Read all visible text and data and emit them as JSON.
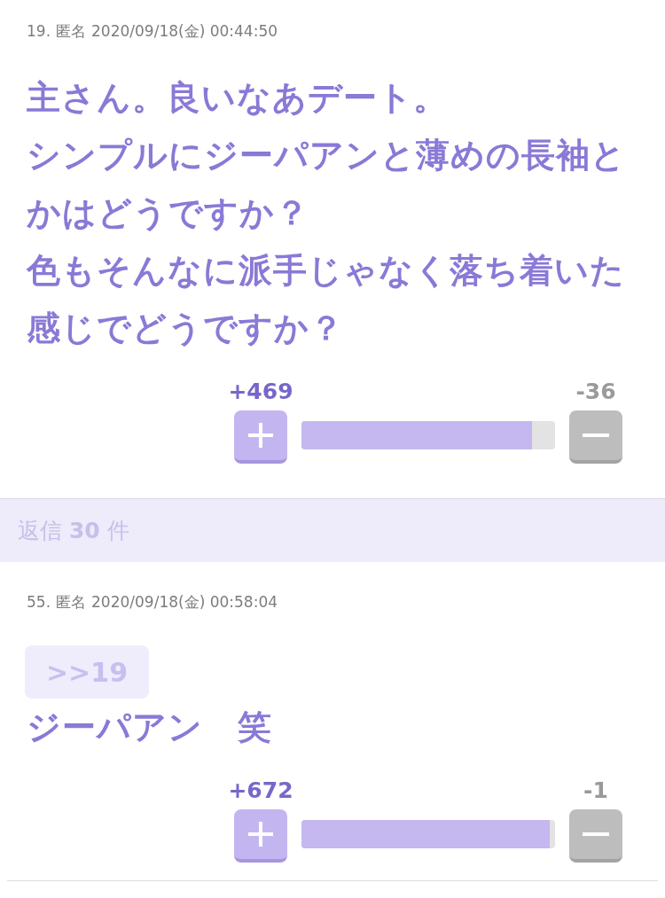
{
  "comments": [
    {
      "number": "19.",
      "name": "匿名",
      "date": "2020/09/18(金) 00:44:50",
      "body": [
        "主さん。良いなあデート。",
        "シンプルにジーパアンと薄めの長袖とかはどうですか？",
        "色もそんなに派手じゃなく落ち着いた感じでどうですか？"
      ],
      "votes": {
        "plus": "+469",
        "minus": "-36",
        "level": 0.91
      },
      "replies": "返信 **30** 件"
    },
    {
      "number": "55.",
      "name": "匿名",
      "date": "2020/09/18(金) 00:58:04",
      "anchor": ">>19",
      "body": [
        "ジーパアン　笑"
      ],
      "votes": {
        "plus": "+672",
        "minus": "-1",
        "level": 0.98
      }
    }
  ]
}
